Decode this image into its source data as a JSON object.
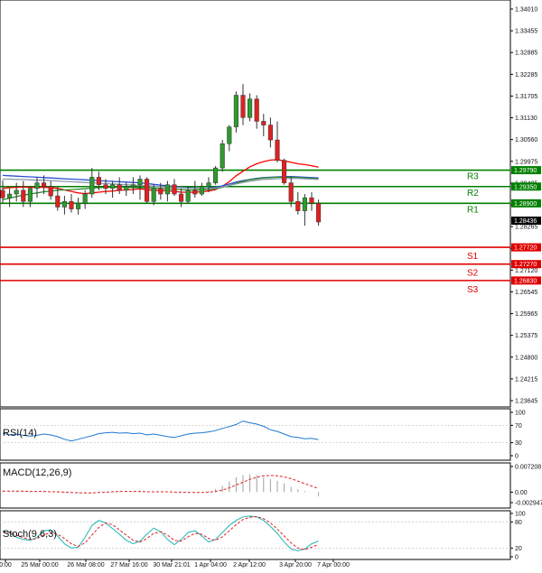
{
  "chart_data": {
    "type": "candlestick",
    "price_axis": {
      "labels": [
        "1.34010",
        "1.33455",
        "1.32885",
        "1.32285",
        "1.31705",
        "1.31130",
        "1.30560",
        "1.29975",
        "1.29405",
        "1.28835",
        "1.28265",
        "1.27695",
        "1.27120",
        "1.26545",
        "1.25965",
        "1.25375",
        "1.24800",
        "1.24215",
        "1.23645"
      ],
      "range": [
        1.2356,
        1.3416
      ]
    },
    "time_axis": {
      "labels": [
        "0:00",
        "25 Mar 00:00",
        "26 Mar 08:00",
        "27 Mar 16:00",
        "30 Mar 21:01",
        "1 Apr 04:00",
        "2 Apr 12:00",
        "3 Apr 20:00",
        "7 Apr 00:00"
      ]
    },
    "current_price": "1.28436",
    "levels": [
      {
        "name": "R3",
        "value": 1.2979,
        "label": "1.29790",
        "color": "#008000"
      },
      {
        "name": "R2",
        "value": 1.2935,
        "label": "1.29350",
        "color": "#008000"
      },
      {
        "name": "R1",
        "value": 1.289,
        "label": "1.28900",
        "color": "#008000"
      },
      {
        "name": "S1",
        "value": 1.2772,
        "label": "1.27720",
        "color": "#e00000"
      },
      {
        "name": "S2",
        "value": 1.2727,
        "label": "1.27270",
        "color": "#e00000"
      },
      {
        "name": "S3",
        "value": 1.2683,
        "label": "1.26830",
        "color": "#e00000"
      }
    ],
    "candles": [
      [
        1.2925,
        1.2952,
        1.289,
        1.2905
      ],
      [
        1.2905,
        1.293,
        1.288,
        1.2915
      ],
      [
        1.2915,
        1.2945,
        1.2895,
        1.2925
      ],
      [
        1.2925,
        1.295,
        1.288,
        1.2895
      ],
      [
        1.2895,
        1.2935,
        1.288,
        1.293
      ],
      [
        1.293,
        1.296,
        1.2905,
        1.2945
      ],
      [
        1.2945,
        1.2965,
        1.2915,
        1.2935
      ],
      [
        1.2935,
        1.295,
        1.29,
        1.291
      ],
      [
        1.291,
        1.2935,
        1.287,
        1.288
      ],
      [
        1.288,
        1.291,
        1.286,
        1.2895
      ],
      [
        1.2895,
        1.2915,
        1.2865,
        1.2875
      ],
      [
        1.2875,
        1.2905,
        1.286,
        1.289
      ],
      [
        1.289,
        1.2925,
        1.2875,
        1.2915
      ],
      [
        1.2915,
        1.2985,
        1.2905,
        1.296
      ],
      [
        1.296,
        1.2975,
        1.2925,
        1.294
      ],
      [
        1.294,
        1.2955,
        1.2915,
        1.293
      ],
      [
        1.293,
        1.295,
        1.2905,
        1.294
      ],
      [
        1.294,
        1.296,
        1.2915,
        1.2925
      ],
      [
        1.2925,
        1.2945,
        1.291,
        1.2935
      ],
      [
        1.2935,
        1.296,
        1.2915,
        1.294
      ],
      [
        1.294,
        1.2965,
        1.29,
        1.2955
      ],
      [
        1.2955,
        1.296,
        1.289,
        1.2895
      ],
      [
        1.2895,
        1.294,
        1.2885,
        1.293
      ],
      [
        1.293,
        1.2945,
        1.29,
        1.2915
      ],
      [
        1.2915,
        1.295,
        1.2895,
        1.294
      ],
      [
        1.294,
        1.2955,
        1.291,
        1.2915
      ],
      [
        1.2915,
        1.293,
        1.288,
        1.2895
      ],
      [
        1.2895,
        1.2935,
        1.289,
        1.2925
      ],
      [
        1.2925,
        1.295,
        1.2905,
        1.2915
      ],
      [
        1.2915,
        1.2945,
        1.291,
        1.2935
      ],
      [
        1.2935,
        1.296,
        1.292,
        1.2945
      ],
      [
        1.2945,
        1.299,
        1.294,
        1.2985
      ],
      [
        1.2985,
        1.306,
        1.2975,
        1.305
      ],
      [
        1.305,
        1.31,
        1.303,
        1.3095
      ],
      [
        1.3095,
        1.319,
        1.308,
        1.318
      ],
      [
        1.318,
        1.321,
        1.31,
        1.312
      ],
      [
        1.312,
        1.3185,
        1.311,
        1.317
      ],
      [
        1.317,
        1.318,
        1.309,
        1.311
      ],
      [
        1.311,
        1.313,
        1.307,
        1.31
      ],
      [
        1.31,
        1.312,
        1.304,
        1.306
      ],
      [
        1.306,
        1.311,
        1.3,
        1.3005
      ],
      [
        1.3005,
        1.301,
        1.294,
        1.2945
      ],
      [
        1.2945,
        1.296,
        1.288,
        1.2895
      ],
      [
        1.2895,
        1.292,
        1.286,
        1.287
      ],
      [
        1.287,
        1.2915,
        1.283,
        1.2905
      ],
      [
        1.2905,
        1.292,
        1.287,
        1.289
      ],
      [
        1.289,
        1.29,
        1.283,
        1.284
      ]
    ],
    "ma_lines": [
      {
        "color": "#ff0000",
        "values": [
          1.293,
          1.2932,
          1.2933,
          1.2934,
          1.2933,
          1.2933,
          1.2933,
          1.2932,
          1.293,
          1.2926,
          1.2922,
          1.2918,
          1.2916,
          1.2918,
          1.292,
          1.2922,
          1.2923,
          1.2925,
          1.2926,
          1.2927,
          1.2929,
          1.2926,
          1.2925,
          1.2924,
          1.2924,
          1.2922,
          1.292,
          1.292,
          1.292,
          1.2921,
          1.2923,
          1.2927,
          1.2936,
          1.2948,
          1.2964,
          1.2976,
          1.2988,
          1.2996,
          1.3002,
          1.3006,
          1.3007,
          1.3004,
          1.3,
          1.2996,
          1.2994,
          1.2991,
          1.2987
        ]
      },
      {
        "color": "#2a4fd6",
        "values": [
          1.2965,
          1.2964,
          1.2963,
          1.2962,
          1.2961,
          1.296,
          1.2959,
          1.2958,
          1.2957,
          1.2956,
          1.2955,
          1.2954,
          1.2953,
          1.2952,
          1.2951,
          1.295,
          1.2949,
          1.2948,
          1.2947,
          1.2946,
          1.2945,
          1.2943,
          1.2941,
          1.2939,
          1.2937,
          1.2935,
          1.2933,
          1.2932,
          1.2931,
          1.293,
          1.2931,
          1.2933,
          1.2937,
          1.2942,
          1.2947,
          1.2951,
          1.2954,
          1.2957,
          1.2959,
          1.296,
          1.2961,
          1.2962,
          1.2962,
          1.2961,
          1.296,
          1.2959,
          1.2958
        ]
      },
      {
        "color": "#2a8c2a",
        "values": [
          1.29,
          1.2904,
          1.2908,
          1.2912,
          1.2915,
          1.2918,
          1.2921,
          1.2923,
          1.2925,
          1.2926,
          1.2927,
          1.2928,
          1.2929,
          1.2931,
          1.2932,
          1.2933,
          1.2933,
          1.2933,
          1.2933,
          1.2932,
          1.2932,
          1.2931,
          1.293,
          1.293,
          1.2929,
          1.2928,
          1.2927,
          1.2926,
          1.2926,
          1.2926,
          1.2927,
          1.2929,
          1.2933,
          1.2938,
          1.2944,
          1.2949,
          1.2953,
          1.2956,
          1.2958,
          1.2959,
          1.296,
          1.296,
          1.296,
          1.2959,
          1.2958,
          1.2957,
          1.2956
        ]
      },
      {
        "color": "#8a9aaa",
        "values": [
          1.2955,
          1.2955,
          1.2954,
          1.2954,
          1.2953,
          1.2952,
          1.2952,
          1.2951,
          1.295,
          1.2949,
          1.2948,
          1.2947,
          1.2946,
          1.2945,
          1.2944,
          1.2943,
          1.2942,
          1.2941,
          1.294,
          1.2939,
          1.2938,
          1.2937,
          1.2936,
          1.2935,
          1.2934,
          1.2933,
          1.2932,
          1.2931,
          1.293,
          1.293,
          1.293,
          1.2931,
          1.2934,
          1.2938,
          1.2942,
          1.2946,
          1.2949,
          1.2952,
          1.2954,
          1.2955,
          1.2956,
          1.2957,
          1.2957,
          1.2957,
          1.2956,
          1.2955,
          1.2954
        ]
      }
    ],
    "rsi": {
      "title": "RSI(14)",
      "axis_labels": [
        "100",
        "70",
        "30",
        "0"
      ],
      "range": [
        0,
        100
      ],
      "values": [
        52,
        48,
        50,
        47,
        45,
        47,
        50,
        48,
        44,
        38,
        34,
        38,
        42,
        46,
        51,
        53,
        54,
        52,
        53,
        51,
        52,
        48,
        50,
        47,
        44,
        42,
        46,
        50,
        52,
        53,
        55,
        58,
        63,
        67,
        72,
        80,
        76,
        73,
        68,
        60,
        56,
        50,
        44,
        42,
        39,
        40,
        37
      ]
    },
    "macd": {
      "title": "MACD(12,26,9)",
      "axis_labels": [
        "0.007208",
        "0.00",
        "-0.002947"
      ],
      "range": [
        -0.002947,
        0.007208
      ],
      "histogram": [
        0.0004,
        0.0003,
        0.0003,
        0.0002,
        0.0001,
        0.0001,
        0.0001,
        0.0,
        -0.0001,
        -0.0002,
        -0.0003,
        -0.0003,
        -0.0002,
        -0.0001,
        0.0001,
        0.0002,
        0.0003,
        0.0002,
        0.0002,
        0.0001,
        0.0002,
        0.0,
        0.0,
        0.0,
        0.0,
        -0.0001,
        -0.0002,
        -0.0002,
        -0.0001,
        0.0,
        0.0003,
        0.0009,
        0.0018,
        0.003,
        0.0042,
        0.0048,
        0.005,
        0.0048,
        0.0042,
        0.0037,
        0.0032,
        0.0025,
        0.0015,
        0.0008,
        0.0003,
        0.0,
        -0.0012
      ],
      "signal": [
        0.0003,
        0.0003,
        0.0003,
        0.0003,
        0.0002,
        0.0002,
        0.0002,
        0.0001,
        0.0001,
        0.0,
        -0.0001,
        -0.0002,
        -0.0002,
        -0.0002,
        -0.0001,
        0.0,
        0.0001,
        0.0002,
        0.0002,
        0.0002,
        0.0002,
        0.0001,
        0.0001,
        0.0001,
        0.0001,
        0.0,
        0.0,
        -0.0001,
        -0.0001,
        -0.0001,
        0.0,
        0.0002,
        0.0006,
        0.0012,
        0.002,
        0.0028,
        0.0036,
        0.0042,
        0.0046,
        0.0047,
        0.0046,
        0.0043,
        0.0038,
        0.0031,
        0.0024,
        0.0017,
        0.001
      ]
    },
    "stoch": {
      "title": "Stoch(9,6,3)",
      "axis_labels": [
        "100",
        "80",
        "20",
        "0"
      ],
      "range": [
        0,
        100
      ],
      "k": [
        60,
        55,
        45,
        40,
        38,
        45,
        60,
        62,
        48,
        30,
        20,
        22,
        45,
        72,
        84,
        78,
        65,
        52,
        38,
        30,
        36,
        52,
        66,
        58,
        40,
        28,
        40,
        56,
        60,
        48,
        34,
        40,
        56,
        72,
        84,
        92,
        94,
        92,
        84,
        70,
        54,
        34,
        18,
        14,
        18,
        30,
        36
      ],
      "d": [
        58,
        56,
        50,
        44,
        40,
        42,
        50,
        56,
        52,
        42,
        30,
        24,
        32,
        50,
        68,
        78,
        74,
        62,
        50,
        38,
        34,
        42,
        54,
        58,
        50,
        38,
        36,
        46,
        54,
        52,
        42,
        38,
        46,
        60,
        74,
        86,
        91,
        93,
        88,
        78,
        64,
        48,
        32,
        20,
        16,
        22,
        28
      ]
    }
  }
}
